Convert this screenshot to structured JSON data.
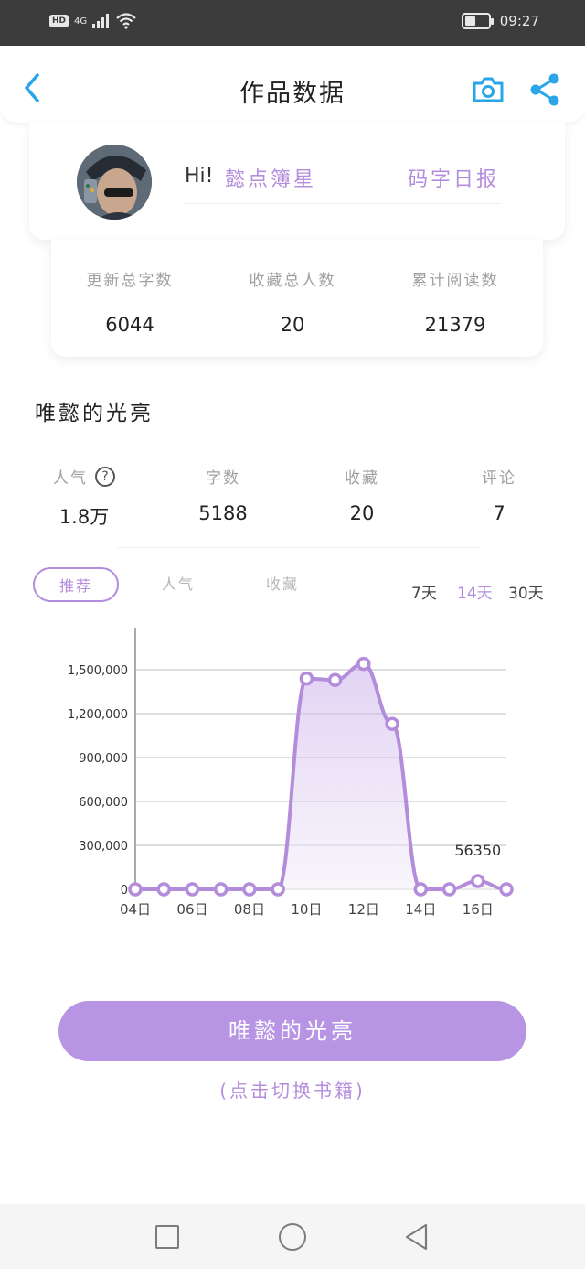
{
  "status_bar": {
    "hd": "HD",
    "signal": "4G",
    "time": "09:27",
    "battery_level": 0.45
  },
  "header": {
    "title": "作品数据"
  },
  "profile": {
    "greeting": "Hi!",
    "name": "懿点簿星",
    "daily_report": "码字日报"
  },
  "stats": [
    {
      "label": "更新总字数",
      "value": "6044"
    },
    {
      "label": "收藏总人数",
      "value": "20"
    },
    {
      "label": "累计阅读数",
      "value": "21379"
    }
  ],
  "book": {
    "title": "唯懿的光亮",
    "metrics": [
      {
        "label": "人气",
        "value": "1.8万"
      },
      {
        "label": "字数",
        "value": "5188"
      },
      {
        "label": "收藏",
        "value": "20"
      },
      {
        "label": "评论",
        "value": "7"
      }
    ]
  },
  "tabs": [
    "推荐",
    "人气",
    "收藏"
  ],
  "ranges": [
    "7天",
    "14天",
    "30天"
  ],
  "colors": {
    "accent": "#b48cdc",
    "button": "#b794e4",
    "icon_blue": "#2aa5e8"
  },
  "chart_data": {
    "type": "area",
    "x": [
      "04日",
      "05日",
      "06日",
      "07日",
      "08日",
      "09日",
      "10日",
      "11日",
      "12日",
      "13日",
      "14日",
      "15日",
      "16日",
      "17日"
    ],
    "xticks": [
      "04日",
      "06日",
      "08日",
      "10日",
      "12日",
      "14日",
      "16日"
    ],
    "values": [
      0,
      0,
      0,
      0,
      0,
      0,
      1440000,
      1430000,
      1540000,
      1130000,
      0,
      0,
      56350,
      0
    ],
    "yticks": [
      "0",
      "300,000",
      "600,000",
      "900,000",
      "1,200,000",
      "1,500,000"
    ],
    "ylim": [
      0,
      1700000
    ],
    "grid": true,
    "annotation": "56350"
  },
  "switch_button": "唯懿的光亮",
  "switch_hint": "(点击切换书籍)"
}
